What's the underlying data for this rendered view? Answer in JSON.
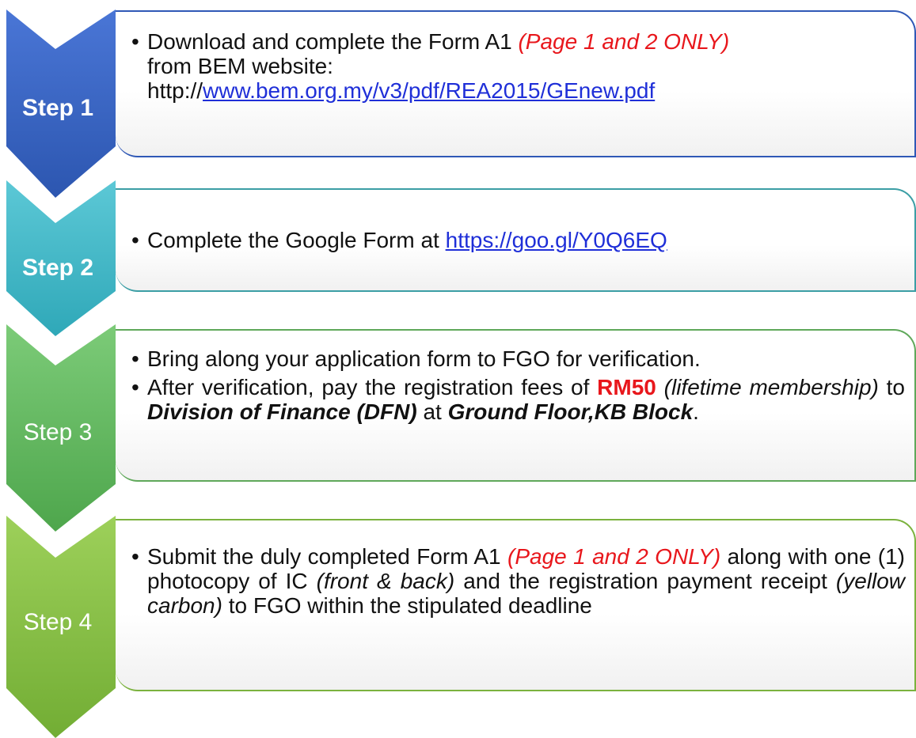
{
  "steps": [
    {
      "label": "Step 1",
      "color": "#3a64c8",
      "bullets": [
        {
          "l1a": "Download and complete the Form A1 ",
          "l1b": "(Page 1 and 2 ONLY)",
          "l2": "from BEM website:",
          "l3a": "http://",
          "l3b": "www.bem.org.my/v3/pdf/REA2015/GEnew.pdf"
        }
      ]
    },
    {
      "label": "Step 2",
      "color": "#3fb4c4",
      "bullets": [
        {
          "a": "Complete the Google Form at ",
          "b": "https://goo.gl/Y0Q6EQ"
        }
      ]
    },
    {
      "label": "Step 3",
      "color": "#5fb860",
      "bullets": [
        {
          "text": "Bring along your application form to FGO for verification."
        },
        {
          "a": "After verification, pay the registration fees of ",
          "b": "RM50",
          "c": " ",
          "d": "(lifetime membership)",
          "e": " to ",
          "f": "Division of Finance (DFN)",
          "g": " at ",
          "h": "Ground Floor,KB Block",
          "i": "."
        }
      ]
    },
    {
      "label": "Step 4",
      "color": "#86bf45",
      "bullets": [
        {
          "a": "Submit the duly completed Form A1 ",
          "b": "(Page 1 and 2 ONLY)",
          "c": " along with one (1) photocopy of IC ",
          "d": "(front & back)",
          "e": " and the registration payment receipt ",
          "f": "(yellow carbon)",
          "g": " to FGO within the stipulated deadline"
        }
      ]
    }
  ],
  "bullet_char": "•"
}
